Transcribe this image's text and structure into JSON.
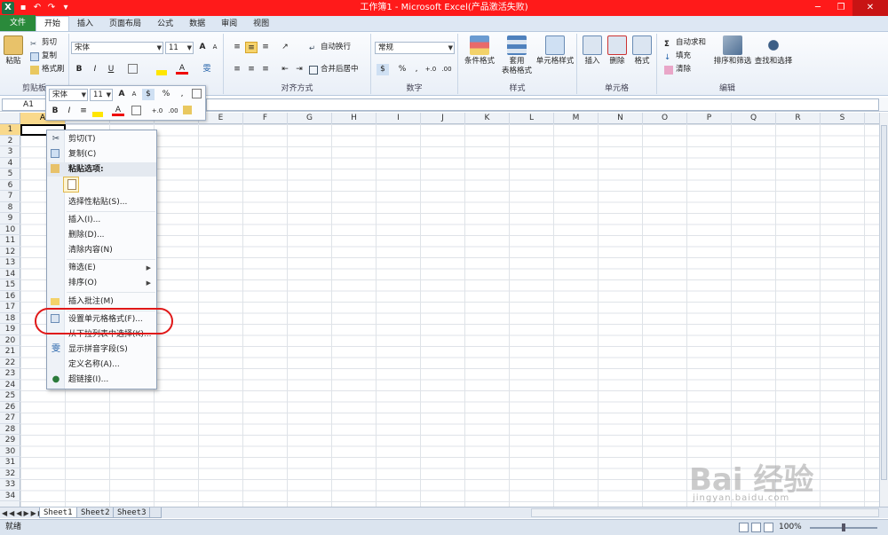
{
  "window": {
    "title": "工作簿1 - Microsoft Excel(产品激活失败)",
    "minimize": "─",
    "maximize": "❐",
    "close": "✕"
  },
  "qat": {
    "app_icon": "X",
    "save": "▪",
    "undo": "↶",
    "redo": "↷",
    "more": "▾"
  },
  "tabs": [
    "文件",
    "开始",
    "插入",
    "页面布局",
    "公式",
    "数据",
    "审阅",
    "视图"
  ],
  "active_tab": "开始",
  "ribbon": {
    "clipboard": {
      "label": "剪贴板",
      "paste": "粘贴",
      "cut": "剪切",
      "copy": "复制",
      "format_painter": "格式刷"
    },
    "font": {
      "name": "宋体",
      "size": "11",
      "bold": "B",
      "italic": "I",
      "underline": "U",
      "grow": "A",
      "shrink": "A",
      "wen": "雯",
      "font_color": "A"
    },
    "alignment": {
      "label": "对齐方式",
      "wrap": "自动换行",
      "merge": "合并后居中"
    },
    "number": {
      "label": "数字",
      "format": "常规",
      "percent": "%",
      "comma": ","
    },
    "styles": {
      "label": "样式",
      "conditional": "条件格式",
      "table_style_line1": "套用",
      "table_style_line2": "表格格式",
      "cell_style": "单元格样式"
    },
    "cells": {
      "label": "单元格",
      "insert": "插入",
      "delete": "删除",
      "format": "格式"
    },
    "editing": {
      "label": "编辑",
      "autosum": "自动求和",
      "fill": "填充",
      "clear": "清除",
      "sort_filter": "排序和筛选",
      "find_select": "查找和选择"
    }
  },
  "formula_bar": {
    "name_box": "A1",
    "formula": ""
  },
  "columns": [
    "A",
    "B",
    "C",
    "D",
    "E",
    "F",
    "G",
    "H",
    "I",
    "J",
    "K",
    "L",
    "M",
    "N",
    "O",
    "P",
    "Q",
    "R",
    "S"
  ],
  "rows": [
    "1",
    "2",
    "3",
    "4",
    "5",
    "6",
    "7",
    "8",
    "9",
    "10",
    "11",
    "12",
    "13",
    "14",
    "15",
    "16",
    "17",
    "18",
    "19",
    "20",
    "21",
    "22",
    "23",
    "24",
    "25",
    "26",
    "27",
    "28",
    "29",
    "30",
    "31",
    "32",
    "33",
    "34"
  ],
  "mini_toolbar": {
    "font": "宋体",
    "size": "11",
    "bold": "B",
    "italic": "I",
    "percent": "%",
    "comma": ","
  },
  "context_menu": [
    {
      "label": "剪切(T)",
      "icon": "cut-icon"
    },
    {
      "label": "复制(C)",
      "icon": "copy-icon"
    },
    {
      "label": "粘贴选项:",
      "icon": "paste-icon",
      "header": true
    },
    {
      "label": "选择性粘贴(S)..."
    },
    {
      "label": "插入(I)..."
    },
    {
      "label": "删除(D)..."
    },
    {
      "label": "清除内容(N)"
    },
    {
      "label": "筛选(E)",
      "submenu": true
    },
    {
      "label": "排序(O)",
      "submenu": true
    },
    {
      "label": "插入批注(M)",
      "icon": "comment-icon"
    },
    {
      "label": "设置单元格格式(F)...",
      "icon": "format-cells-icon"
    },
    {
      "label": "从下拉列表中选择(K)..."
    },
    {
      "label": "显示拼音字段(S)",
      "icon": "phonetic-icon"
    },
    {
      "label": "定义名称(A)..."
    },
    {
      "label": "超链接(I)...",
      "icon": "hyperlink-icon"
    }
  ],
  "sheets": [
    "Sheet1",
    "Sheet2",
    "Sheet3"
  ],
  "active_sheet": "Sheet1",
  "status": {
    "ready": "就绪",
    "zoom": "100%"
  },
  "watermark": {
    "brand": "Bai 经验",
    "url": "jingyan.baidu.com"
  }
}
